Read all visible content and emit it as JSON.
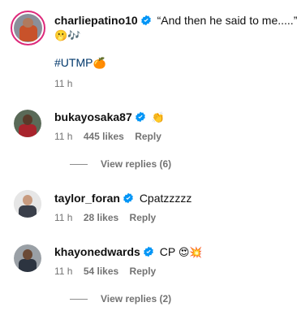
{
  "comments": [
    {
      "username": "charliepatino10",
      "text": "“And then he said to me.....”",
      "text_emoji": "🫢🎶",
      "hashtag": "#UTMP",
      "hashtag_emoji": "🍊",
      "time": "11 h"
    },
    {
      "username": "bukayosaka87",
      "text": "",
      "text_emoji": "👏",
      "time": "11 h",
      "likes": "445 likes",
      "reply": "Reply",
      "view_replies": "View replies (6)"
    },
    {
      "username": "taylor_foran",
      "text": "Cpatzzzzz",
      "time": "11 h",
      "likes": "28 likes",
      "reply": "Reply"
    },
    {
      "username": "khayonedwards",
      "text": "CP",
      "text_emoji": "😍💥",
      "time": "11 h",
      "likes": "54 likes",
      "reply": "Reply",
      "view_replies": "View replies (2)"
    }
  ],
  "colors": {
    "verified": "#0095f6",
    "meta": "#737373",
    "story_ring": "#dd2a7b"
  }
}
